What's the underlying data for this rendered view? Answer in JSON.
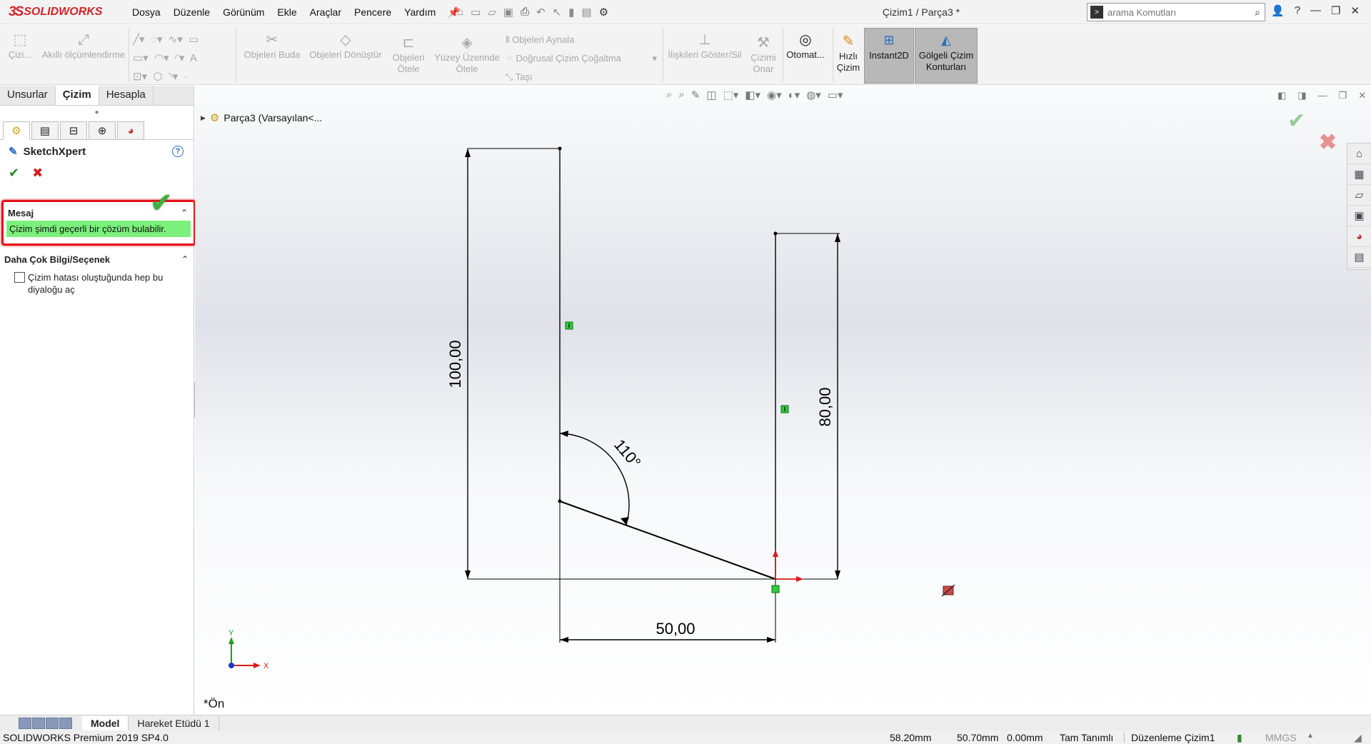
{
  "app": {
    "logo_mark": "3S",
    "logo_text": "SOLIDWORKS",
    "window_title": "Çizim1 / Parça3 *",
    "menu": [
      "Dosya",
      "Düzenle",
      "Görünüm",
      "Ekle",
      "Araçlar",
      "Pencere",
      "Yardım"
    ]
  },
  "search": {
    "placeholder": "arama Komutları"
  },
  "ribbon": {
    "cizim": "Çizi...",
    "akilli": "Akıllı ölçümlendirme",
    "buda": "Objeleri Buda",
    "donustur": "Objeleri Dönüştür",
    "otele1": "Objeleri",
    "otele2": "Ötele",
    "yuzey1": "Yüzey Üzerinde",
    "yuzey2": "Ötele",
    "aynala": "Objeleri Aynala",
    "cogaltma": "Doğrusal Çizim Çoğaltma",
    "tasi": "Taşı",
    "iliskiler": "İlişkileri Göster/Sil",
    "onar1": "Çizimi",
    "onar2": "Onar",
    "otomat": "Otomat...",
    "hizli1": "Hızlı",
    "hizli2": "Çizim",
    "instant2d": "Instant2D",
    "golgeli1": "Gölgeli Çizim",
    "golgeli2": "Konturları"
  },
  "panel": {
    "tabs": [
      "Unsurlar",
      "Çizim",
      "Hesapla"
    ],
    "active_tab": "Çizim",
    "pm_title": "SketchXpert",
    "help": "?",
    "message_group": "Mesaj",
    "message": "Çizim şimdi geçerli bir çözüm bulabilir.",
    "options_group": "Daha Çok Bilgi/Seçenek",
    "checkbox_label": "Çizim hatası oluştuğunda hep bu diyaloğu aç",
    "checkbox_checked": false
  },
  "viewport": {
    "tree_label": "Parça3  (Varsayılan<...",
    "view_name": "*Ön",
    "dimensions": {
      "height_left": "100,00",
      "height_right": "80,00",
      "width_bottom": "50,00",
      "angle": "110°"
    },
    "triad_x": "X",
    "triad_y": "Y"
  },
  "bottom_tabs": [
    "Model",
    "Hareket Etüdü 1"
  ],
  "active_bottom_tab": "Model",
  "status": {
    "product": "SOLIDWORKS Premium 2019 SP4.0",
    "x": "58.20mm",
    "y": "50.70mm",
    "z": "0.00mm",
    "state": "Tam Tanımlı",
    "editing": "Düzenleme Çizim1",
    "units": "MMGS"
  },
  "colors": {
    "highlight_red": "#e3141a",
    "message_green": "#7cf07c",
    "logo_red": "#d2232a"
  }
}
